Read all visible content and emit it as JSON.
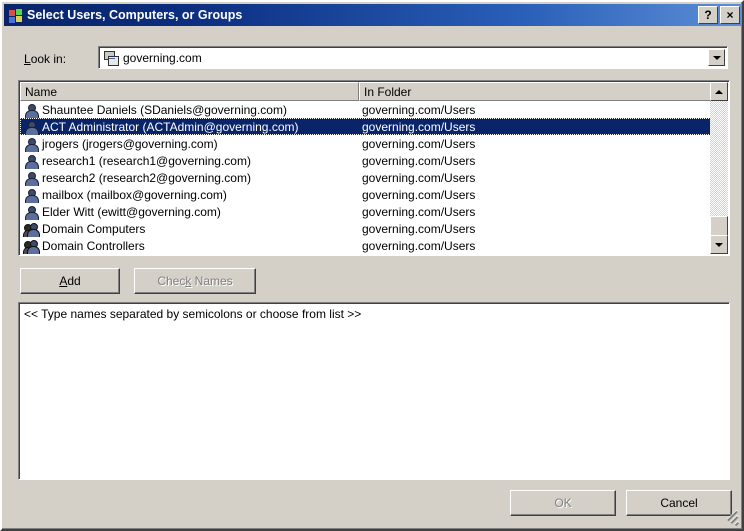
{
  "window": {
    "title": "Select Users, Computers, or Groups",
    "icon": "windows-flag-icon",
    "help_label": "?",
    "close_label": "×"
  },
  "lookin": {
    "label_prefix": "L",
    "label_rest": "ook in:",
    "value": "governing.com",
    "icon": "domain-servers-icon"
  },
  "list": {
    "columns": [
      {
        "label": "Name"
      },
      {
        "label": "In Folder"
      }
    ],
    "rows": [
      {
        "name": "Shauntee Daniels (SDaniels@governing.com)",
        "folder": "governing.com/Users",
        "icon": "user-icon",
        "selected": false
      },
      {
        "name": "ACT Administrator (ACTAdmin@governing.com)",
        "folder": "governing.com/Users",
        "icon": "user-icon",
        "selected": true
      },
      {
        "name": "jrogers (jrogers@governing.com)",
        "folder": "governing.com/Users",
        "icon": "user-icon",
        "selected": false
      },
      {
        "name": "research1 (research1@governing.com)",
        "folder": "governing.com/Users",
        "icon": "user-icon",
        "selected": false
      },
      {
        "name": "research2 (research2@governing.com)",
        "folder": "governing.com/Users",
        "icon": "user-icon",
        "selected": false
      },
      {
        "name": "mailbox (mailbox@governing.com)",
        "folder": "governing.com/Users",
        "icon": "user-icon",
        "selected": false
      },
      {
        "name": "Elder Witt (ewitt@governing.com)",
        "folder": "governing.com/Users",
        "icon": "user-icon",
        "selected": false
      },
      {
        "name": "Domain Computers",
        "folder": "governing.com/Users",
        "icon": "group-icon",
        "selected": false
      },
      {
        "name": "Domain Controllers",
        "folder": "governing.com/Users",
        "icon": "group-icon",
        "selected": false
      }
    ]
  },
  "buttons": {
    "add": {
      "label_before": "A",
      "label_accel": "",
      "label": "Add",
      "enabled": true
    },
    "check_names": {
      "label": "Check Names",
      "enabled": false
    },
    "ok": {
      "label": "OK",
      "enabled": false
    },
    "cancel": {
      "label": "Cancel",
      "enabled": true
    }
  },
  "names_field": {
    "value": "<< Type names separated by semicolons or choose from list >>"
  },
  "colors": {
    "dialog_face": "#d4d0c8",
    "title_active_start": "#0a246a",
    "title_active_end": "#5c8ed6",
    "selection": "#0a246a",
    "disabled_text": "#808080"
  }
}
